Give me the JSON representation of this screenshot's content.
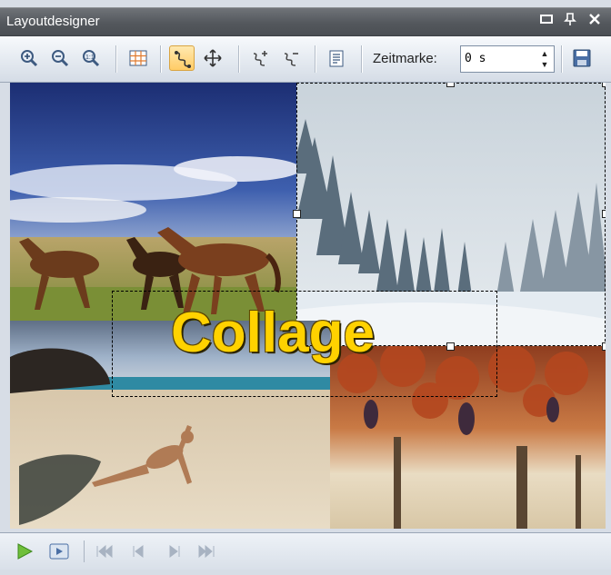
{
  "window": {
    "title": "Layoutdesigner"
  },
  "title_buttons": [
    {
      "icon": "minimize-icon",
      "glyph": "▬"
    },
    {
      "icon": "pin-icon",
      "glyph": "ꟷ"
    },
    {
      "icon": "close-icon",
      "glyph": "✕"
    }
  ],
  "toolbar": {
    "zeitmarke_label": "Zeitmarke:",
    "zeitmarke_value": "0 s",
    "tools": [
      {
        "icon": "zoom-in-icon"
      },
      {
        "icon": "zoom-out-icon"
      },
      {
        "icon": "zoom-fit-icon"
      },
      {
        "icon": "grid-icon"
      },
      {
        "icon": "motion-path-icon",
        "active": true
      },
      {
        "icon": "move-icon"
      },
      {
        "icon": "add-keyframe-icon"
      },
      {
        "icon": "remove-keyframe-icon"
      },
      {
        "icon": "align-icon"
      },
      {
        "icon": "save-icon"
      }
    ]
  },
  "canvas": {
    "overlay_text": "Collage",
    "photos": [
      "horses",
      "winter-forest",
      "beach",
      "vineyard"
    ]
  },
  "playback": {
    "buttons": [
      "play-icon",
      "preview-icon",
      "first-frame-icon",
      "previous-frame-icon",
      "next-frame-icon",
      "last-frame-icon"
    ]
  },
  "colors": {
    "accent": "#ffcc66",
    "overlay_text": "#ffd200"
  }
}
